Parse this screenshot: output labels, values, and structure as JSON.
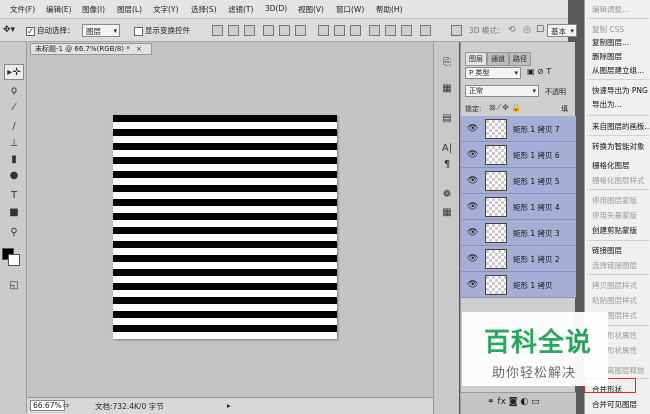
{
  "menubar": {
    "items": [
      "文件(F)",
      "编辑(E)",
      "图像(I)",
      "图层(L)",
      "文字(Y)",
      "选择(S)",
      "滤镜(T)",
      "3D(D)",
      "视图(V)",
      "窗口(W)",
      "帮助(H)"
    ]
  },
  "options_bar": {
    "auto_select_label": "自动选择：",
    "auto_select_value": "图层",
    "show_transform_label": "显示变换控件",
    "mode_3d_label": "3D 模式：",
    "workspace_value": "基本"
  },
  "document": {
    "tab_title": "未标题-1 @ 66.7%(RGB/8) *",
    "close_glyph": "×",
    "zoom": "66.67%",
    "doc_info": "文档:732.4K/0 字节",
    "stripe_count": 16
  },
  "layers_panel": {
    "tabs": [
      "图层",
      "通道",
      "路径"
    ],
    "filter_value": "P 类型",
    "blend_mode": "正常",
    "opacity_label": "不透明",
    "lock_label": "锁定:",
    "fill_label": "填",
    "layers": [
      {
        "name": "矩形 1 拷贝 7"
      },
      {
        "name": "矩形 1 拷贝 6"
      },
      {
        "name": "矩形 1 拷贝 5"
      },
      {
        "name": "矩形 1 拷贝 4"
      },
      {
        "name": "矩形 1 拷贝 3"
      },
      {
        "name": "矩形 1 拷贝 2"
      },
      {
        "name": "矩形 1 拷贝"
      }
    ]
  },
  "context_menu": {
    "items": [
      {
        "label": "编辑调整...",
        "disabled": true
      },
      {
        "label": "复制 CSS",
        "disabled": true
      },
      {
        "label": "复制图层...",
        "disabled": false
      },
      {
        "label": "删除图层",
        "disabled": false
      },
      {
        "label": "从图层建立组...",
        "disabled": false
      },
      {
        "label": "快速导出为 PNG",
        "disabled": false
      },
      {
        "label": "导出为...",
        "disabled": false
      },
      {
        "label": "来自图层的画板...",
        "disabled": false
      },
      {
        "label": "转换为智能对象",
        "disabled": false
      },
      {
        "label": "栅格化图层",
        "disabled": false
      },
      {
        "label": "栅格化图层样式",
        "disabled": true
      },
      {
        "label": "停用图层蒙版",
        "disabled": true
      },
      {
        "label": "停用矢量蒙版",
        "disabled": true
      },
      {
        "label": "创建剪贴蒙版",
        "disabled": false
      },
      {
        "label": "链接图层",
        "disabled": false
      },
      {
        "label": "选择链接图层",
        "disabled": true
      },
      {
        "label": "拷贝图层样式",
        "disabled": true
      },
      {
        "label": "粘贴图层样式",
        "disabled": true
      },
      {
        "label": "清除图层样式",
        "disabled": true
      },
      {
        "label": "复制形状属性",
        "disabled": true
      },
      {
        "label": "粘贴形状属性",
        "disabled": true
      },
      {
        "label": "从隔离图层释放",
        "disabled": true
      },
      {
        "label": "合并形状",
        "disabled": false
      },
      {
        "label": "合并可见图层",
        "disabled": false
      }
    ]
  },
  "watermark": {
    "title": "百科全说",
    "subtitle": "助你轻松解决"
  }
}
